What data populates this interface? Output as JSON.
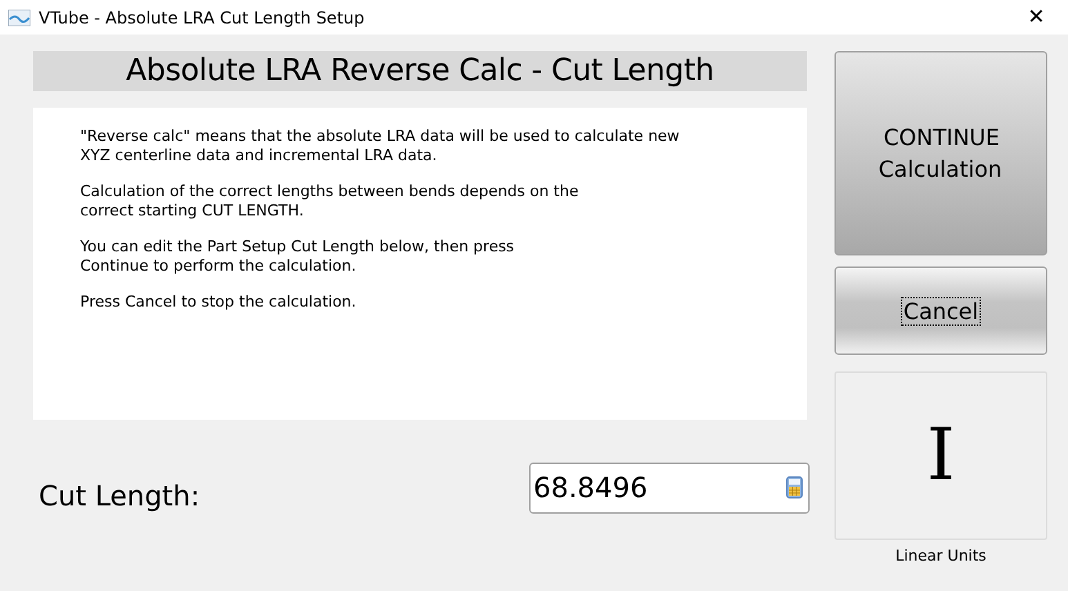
{
  "window": {
    "title": "VTube - Absolute LRA Cut Length Setup",
    "close": "✕"
  },
  "heading": "Absolute LRA Reverse Calc - Cut Length",
  "message": [
    "\"Reverse calc\" means that the absolute LRA data will be used to calculate new\nXYZ centerline data and incremental LRA data.",
    "Calculation of the correct lengths between bends depends on the\ncorrect starting CUT LENGTH.",
    "You can edit the Part Setup Cut Length below, then press\nContinue to perform the calculation.",
    "Press Cancel to stop the calculation."
  ],
  "cut_length": {
    "label": "Cut Length:",
    "value": "68.8496"
  },
  "buttons": [
    {
      "kind": "primary",
      "label": "CONTINUE\nCalculation",
      "focused": false
    },
    {
      "kind": "secondary",
      "label": "Cancel",
      "focused": true
    }
  ],
  "units": {
    "symbol": "I",
    "label": "Linear Units"
  }
}
